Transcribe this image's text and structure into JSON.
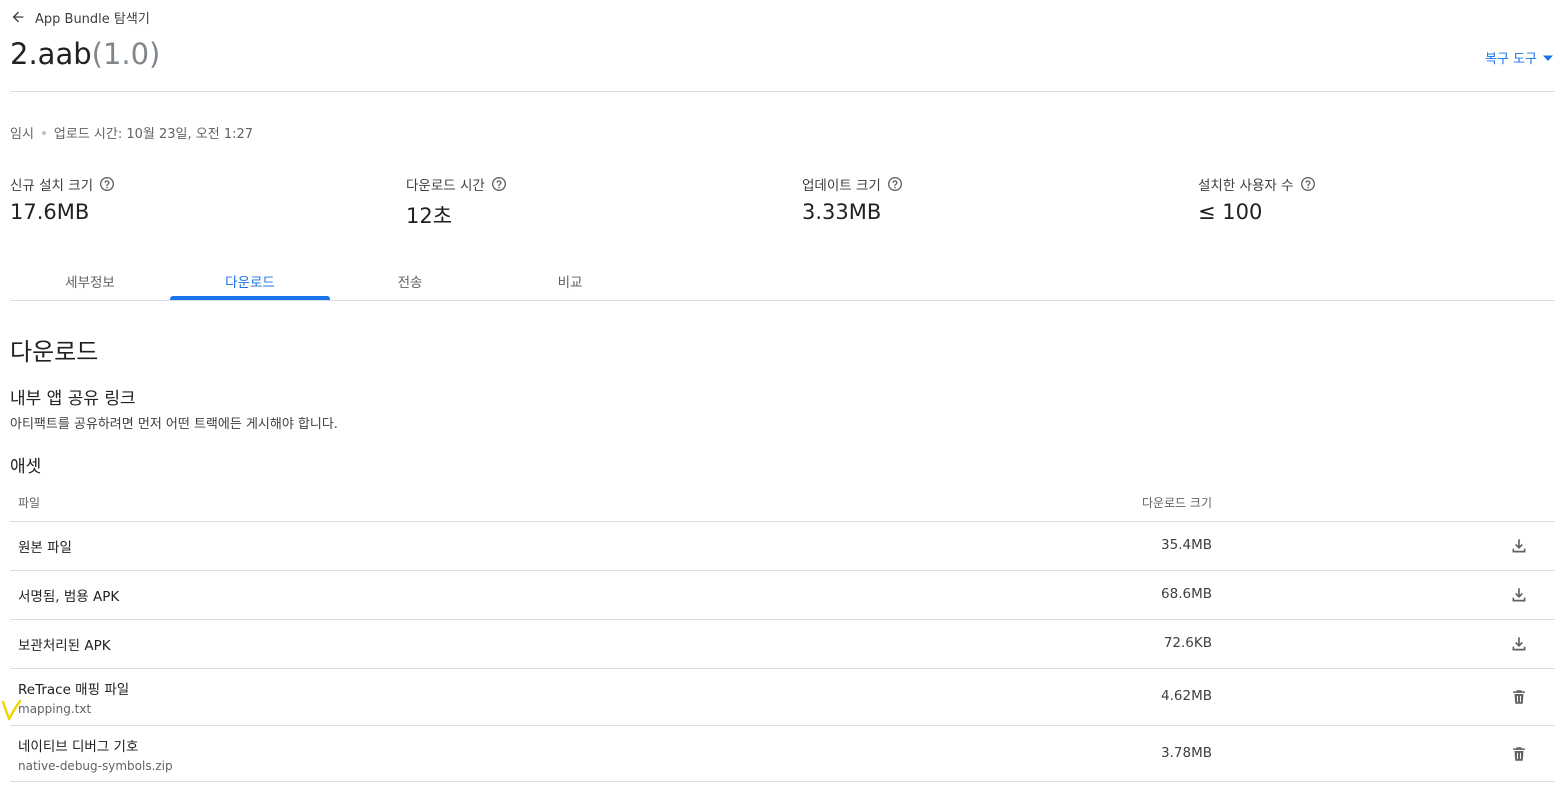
{
  "header": {
    "back_label": "App Bundle 탐색기",
    "title_name": "2.aab",
    "title_version": "(1.0)",
    "recovery_label": "복구 도구"
  },
  "status": {
    "track": "임시",
    "upload_time": "업로드 시간: 10월 23일, 오전 1:27"
  },
  "stats": [
    {
      "label": "신규 설치 크기",
      "value": "17.6MB"
    },
    {
      "label": "다운로드 시간",
      "value": "12초"
    },
    {
      "label": "업데이트 크기",
      "value": "3.33MB"
    },
    {
      "label": "설치한 사용자 수",
      "value": "≤ 100"
    }
  ],
  "tabs": [
    {
      "label": "세부정보",
      "active": false
    },
    {
      "label": "다운로드",
      "active": true
    },
    {
      "label": "전송",
      "active": false
    },
    {
      "label": "비교",
      "active": false
    }
  ],
  "downloads": {
    "heading": "다운로드",
    "share_heading": "내부 앱 공유 링크",
    "share_desc": "아티팩트를 공유하려면 먼저 어떤 트랙에든 게시해야 합니다.",
    "assets_heading": "애셋",
    "table": {
      "col_file": "파일",
      "col_size": "다운로드 크기",
      "rows": [
        {
          "name": "원본 파일",
          "sub": "",
          "size": "35.4MB",
          "icon": "download-icon"
        },
        {
          "name": "서명됨, 범용 APK",
          "sub": "",
          "size": "68.6MB",
          "icon": "download-icon"
        },
        {
          "name": "보관처리된 APK",
          "sub": "",
          "size": "72.6KB",
          "icon": "download-icon"
        },
        {
          "name": "ReTrace 매핑 파일",
          "sub": "mapping.txt",
          "size": "4.62MB",
          "icon": "delete-icon"
        },
        {
          "name": "네이티브 디버그 기호",
          "sub": "native-debug-symbols.zip",
          "size": "3.78MB",
          "icon": "delete-icon"
        }
      ]
    }
  },
  "colors": {
    "accent": "#1a73e8",
    "annotation": "#f4d400"
  }
}
